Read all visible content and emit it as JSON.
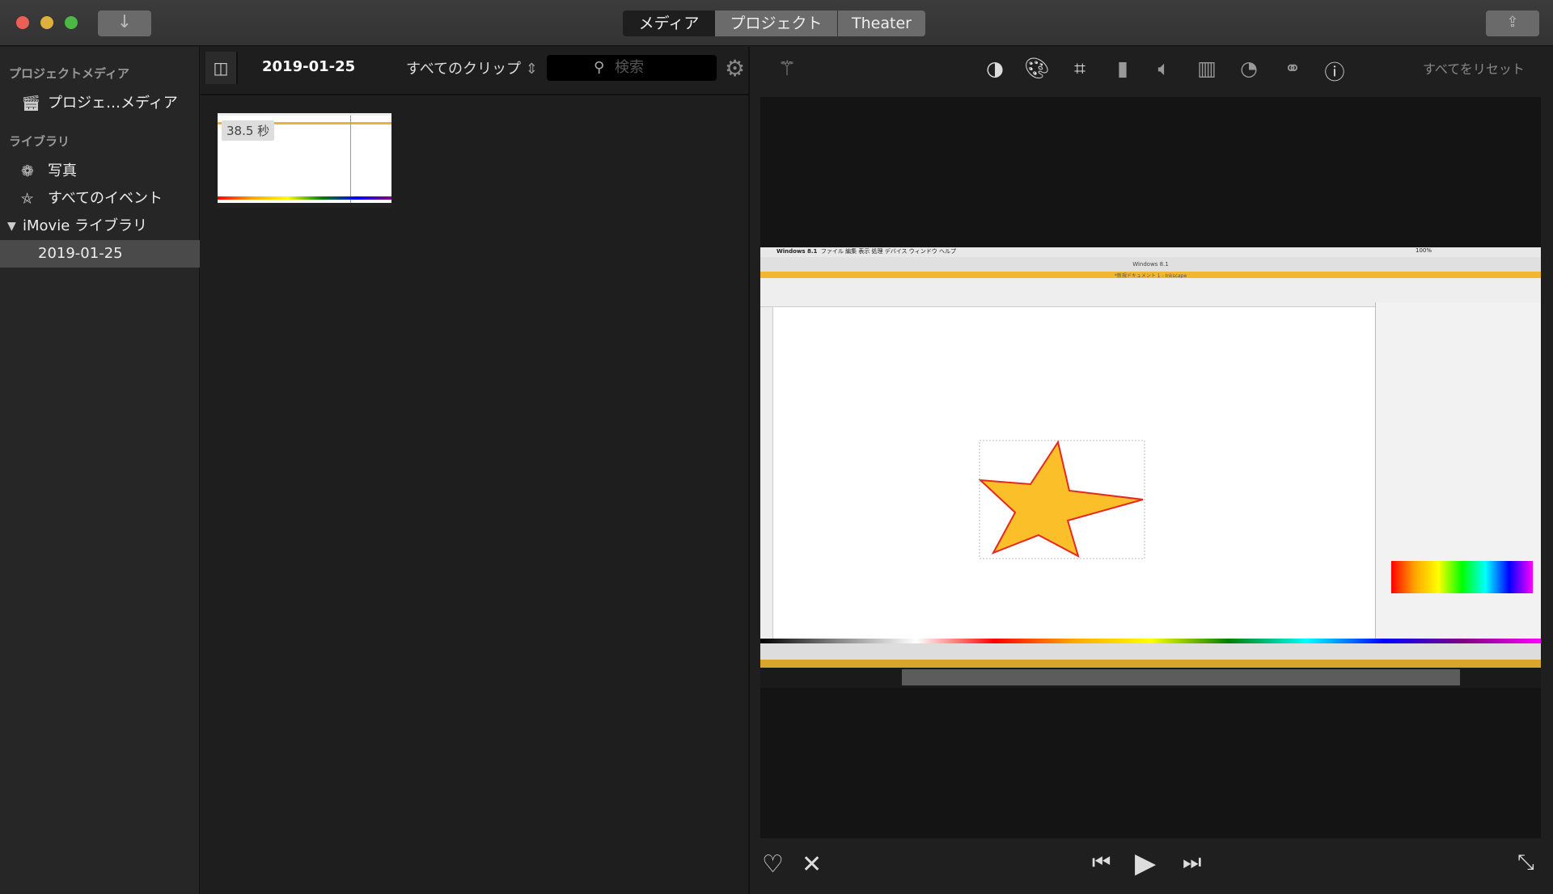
{
  "titlebar": {
    "import_icon": "arrow-down-icon",
    "tabs": [
      {
        "label": "メディア",
        "active": true
      },
      {
        "label": "プロジェクト",
        "active": false
      },
      {
        "label": "Theater",
        "active": false
      }
    ],
    "share_icon": "share-icon"
  },
  "sidebar": {
    "project_media_header": "プロジェクトメディア",
    "project_media_item": "プロジェ…メディア",
    "library_header": "ライブラリ",
    "items": [
      {
        "label": "写真",
        "icon": "photos-icon"
      },
      {
        "label": "すべてのイベント",
        "icon": "star-icon"
      }
    ],
    "library_name": "iMovie ライブラリ",
    "event": "2019-01-25"
  },
  "browser": {
    "title": "2019-01-25",
    "filter": "すべてのクリップ",
    "search_placeholder": "検索",
    "clip": {
      "duration": "38.5 秒"
    }
  },
  "viewer": {
    "tools": [
      "magic-wand",
      "color-balance",
      "color-correction",
      "crop",
      "stabilization",
      "volume",
      "noise-reduction",
      "speed",
      "clip-filter",
      "info"
    ],
    "reset_label": "すべてをリセット",
    "video": {
      "menubar_title": "Windows 8.1",
      "menus": "ファイル  編集  表示  処理  デバイス  ウィンドウ  ヘルプ",
      "window_title": "Windows 8.1",
      "doc_title": "*新規ドキュメント 1 - Inkscape",
      "zoom_readout": "100%",
      "star_fill": "#fbbf2a",
      "star_stroke": "#e8281e"
    }
  },
  "controls": {
    "favorite": "heart-icon",
    "reject": "reject-icon",
    "prev": "skip-back-icon",
    "play": "play-icon",
    "next": "skip-forward-icon",
    "fullscreen": "fullscreen-icon"
  }
}
